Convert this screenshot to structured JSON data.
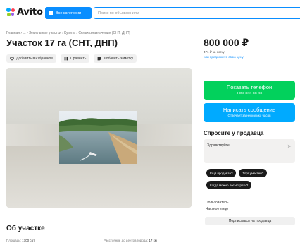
{
  "header": {
    "logo_text": "Avito",
    "categories_label": "Все категории",
    "search_placeholder": "Поиск по объявлениям"
  },
  "breadcrumbs": "Главная › ... › Земельные участки › Купить › Сельхозназначения (СНТ, ДНП)",
  "listing": {
    "title": "Участок 17 га (СНТ, ДНП)",
    "actions": {
      "favorite": "Добавить в избранное",
      "compare": "Сравнить",
      "note": "Добавить заметку"
    }
  },
  "pricing": {
    "price": "800 000 ₽",
    "price_per_unit": "471 ₽ за сотку",
    "suggest_price": "или предложите свою цену"
  },
  "contact": {
    "phone_label": "Показать телефон",
    "phone_masked": "8 958 XXX-XX-XX",
    "message_label": "Написать сообщение",
    "message_sub": "Отвечает за несколько часов"
  },
  "ask_seller": {
    "title": "Спросите у продавца",
    "message_value": "Здравствуйте!",
    "quick_questions": [
      "Ещё продаёте?",
      "Торг уместен?",
      "Когда можно посмотреть?"
    ]
  },
  "seller": {
    "label": "Пользователь",
    "type": "Частное лицо",
    "subscribe_label": "Подписаться на продавца"
  },
  "about": {
    "title": "Об участке",
    "area_label": "Площадь:",
    "area_value": "1700 сот.",
    "distance_label": "Расстояние до центра города:",
    "distance_value": "17 км"
  },
  "colors": {
    "accent_blue": "#0a8eff",
    "phone_green": "#02d15c",
    "message_blue": "#00aaff"
  }
}
